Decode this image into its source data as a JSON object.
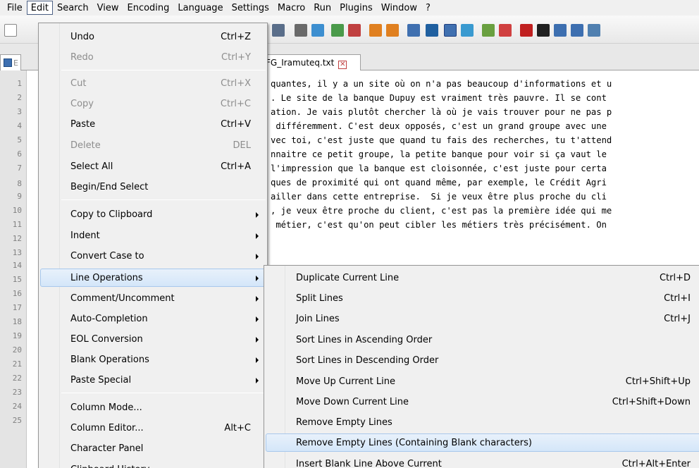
{
  "menubar": [
    "File",
    "Edit",
    "Search",
    "View",
    "Encoding",
    "Language",
    "Settings",
    "Macro",
    "Run",
    "Plugins",
    "Window",
    "?"
  ],
  "tab": {
    "name": "FG_Iramuteq.txt",
    "left_stub": "E"
  },
  "gutter": [
    "1",
    "2",
    "3",
    "4",
    "5",
    "6",
    "7",
    "8",
    "9",
    "10",
    "11",
    "12",
    "13",
    "14",
    "15",
    "16",
    "17",
    "18",
    "19",
    "20",
    "21",
    "22",
    "23",
    "24",
    "25"
  ],
  "code_lines": [
    "quantes, il y a un site où on n'a pas beaucoup d'informations et u",
    ". Le site de la banque Dupuy est vraiment très pauvre. Il se cont",
    "ation. Je vais plutôt chercher là où je vais trouver pour ne pas p",
    " différemment. C'est deux opposés, c'est un grand groupe avec une",
    "vec toi, c'est juste que quand tu fais des recherches, tu t'attend",
    "nnaitre ce petit groupe, la petite banque pour voir si ça vaut le",
    "l'impression que la banque est cloisonnée, c'est juste pour certa",
    "ques de proximité qui ont quand même, par exemple, le Crédit Agri",
    "ailler dans cette entreprise.  Si je veux être plus proche du cli",
    ", je veux être proche du client, c'est pas la première idée qui me",
    " métier, c'est qu'on peut cibler les métiers très précisément. On"
  ],
  "edit_menu": [
    {
      "label": "Undo",
      "shortcut": "Ctrl+Z"
    },
    {
      "label": "Redo",
      "shortcut": "Ctrl+Y",
      "disabled": true
    },
    {
      "label": "Cut",
      "shortcut": "Ctrl+X",
      "disabled": true
    },
    {
      "label": "Copy",
      "shortcut": "Ctrl+C",
      "disabled": true
    },
    {
      "label": "Paste",
      "shortcut": "Ctrl+V"
    },
    {
      "label": "Delete",
      "shortcut": "DEL",
      "disabled": true
    },
    {
      "label": "Select All",
      "shortcut": "Ctrl+A"
    },
    {
      "label": "Begin/End Select",
      "shortcut": ""
    },
    {
      "label": "Copy to Clipboard",
      "shortcut": "",
      "submenu": true
    },
    {
      "label": "Indent",
      "shortcut": "",
      "submenu": true
    },
    {
      "label": "Convert Case to",
      "shortcut": "",
      "submenu": true
    },
    {
      "label": "Line Operations",
      "shortcut": "",
      "submenu": true,
      "highlighted": true
    },
    {
      "label": "Comment/Uncomment",
      "shortcut": "",
      "submenu": true
    },
    {
      "label": "Auto-Completion",
      "shortcut": "",
      "submenu": true
    },
    {
      "label": "EOL Conversion",
      "shortcut": "",
      "submenu": true
    },
    {
      "label": "Blank Operations",
      "shortcut": "",
      "submenu": true
    },
    {
      "label": "Paste Special",
      "shortcut": "",
      "submenu": true
    },
    {
      "label": "Column Mode...",
      "shortcut": ""
    },
    {
      "label": "Column Editor...",
      "shortcut": "Alt+C"
    },
    {
      "label": "Character Panel",
      "shortcut": ""
    },
    {
      "label": "Clipboard History",
      "shortcut": ""
    }
  ],
  "line_ops_menu": [
    {
      "label": "Duplicate Current Line",
      "shortcut": "Ctrl+D"
    },
    {
      "label": "Split Lines",
      "shortcut": "Ctrl+I"
    },
    {
      "label": "Join Lines",
      "shortcut": "Ctrl+J"
    },
    {
      "label": "Sort Lines in Ascending Order",
      "shortcut": ""
    },
    {
      "label": "Sort Lines in Descending Order",
      "shortcut": ""
    },
    {
      "label": "Move Up Current Line",
      "shortcut": "Ctrl+Shift+Up"
    },
    {
      "label": "Move Down Current Line",
      "shortcut": "Ctrl+Shift+Down"
    },
    {
      "label": "Remove Empty Lines",
      "shortcut": ""
    },
    {
      "label": "Remove Empty Lines (Containing Blank characters)",
      "shortcut": "",
      "highlighted": true
    },
    {
      "label": "Insert Blank Line Above Current",
      "shortcut": "Ctrl+Alt+Enter"
    }
  ],
  "colors": {
    "highlight_bg": "#d4e6f9",
    "highlight_border": "#a8c8ec",
    "disabled_text": "#8d8d8d"
  }
}
